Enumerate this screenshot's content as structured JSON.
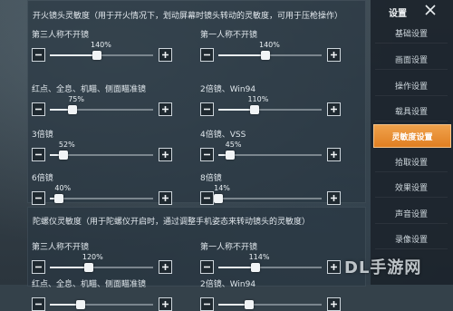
{
  "colors": {
    "accent": "#e8892a",
    "panel": "#2a3742",
    "track": "#7b868e",
    "thumb": "#f1f4f6"
  },
  "sidebar": {
    "title": "设置",
    "close_icon": "close-icon",
    "items": [
      {
        "label": "基础设置",
        "active": false
      },
      {
        "label": "画面设置",
        "active": false
      },
      {
        "label": "操作设置",
        "active": false
      },
      {
        "label": "载具设置",
        "active": false
      },
      {
        "label": "灵敏度设置",
        "active": true
      },
      {
        "label": "拾取设置",
        "active": false
      },
      {
        "label": "效果设置",
        "active": false
      },
      {
        "label": "声音设置",
        "active": false
      },
      {
        "label": "录像设置",
        "active": false
      }
    ]
  },
  "section1": {
    "title": "开火镜头灵敏度（用于开火情况下，划动屏幕时镜头转动的灵敏度，可用于压枪操作）",
    "sliders": [
      {
        "label": "第三人称不开镜",
        "value": "140%",
        "level": 0.46
      },
      {
        "label": "第一人称不开镜",
        "value": "140%",
        "level": 0.46
      },
      {
        "label": "红点、全息、机瞄、侧面瞄准镜",
        "value": "75%",
        "level": 0.22
      },
      {
        "label": "2倍镜、Win94",
        "value": "110%",
        "level": 0.35
      },
      {
        "label": "3倍镜",
        "value": "52%",
        "level": 0.13
      },
      {
        "label": "4倍镜、VSS",
        "value": "45%",
        "level": 0.11
      },
      {
        "label": "6倍镜",
        "value": "40%",
        "level": 0.09
      },
      {
        "label": "8倍镜",
        "value": "14%",
        "level": 0.0
      }
    ]
  },
  "section2": {
    "title": "陀螺仪灵敏度（用于陀螺仪开启时，通过调整手机姿态来转动镜头的灵敏度）",
    "sliders": [
      {
        "label": "第三人称不开镜",
        "value": "120%",
        "level": 0.38
      },
      {
        "label": "第一人称不开镜",
        "value": "114%",
        "level": 0.36
      },
      {
        "label": "红点、全息、机瞄、侧面瞄准镜",
        "value": "",
        "level": 0.3
      },
      {
        "label": "2倍镜、Win94",
        "value": "",
        "level": 0.3
      }
    ]
  },
  "watermark": "DL手游网"
}
